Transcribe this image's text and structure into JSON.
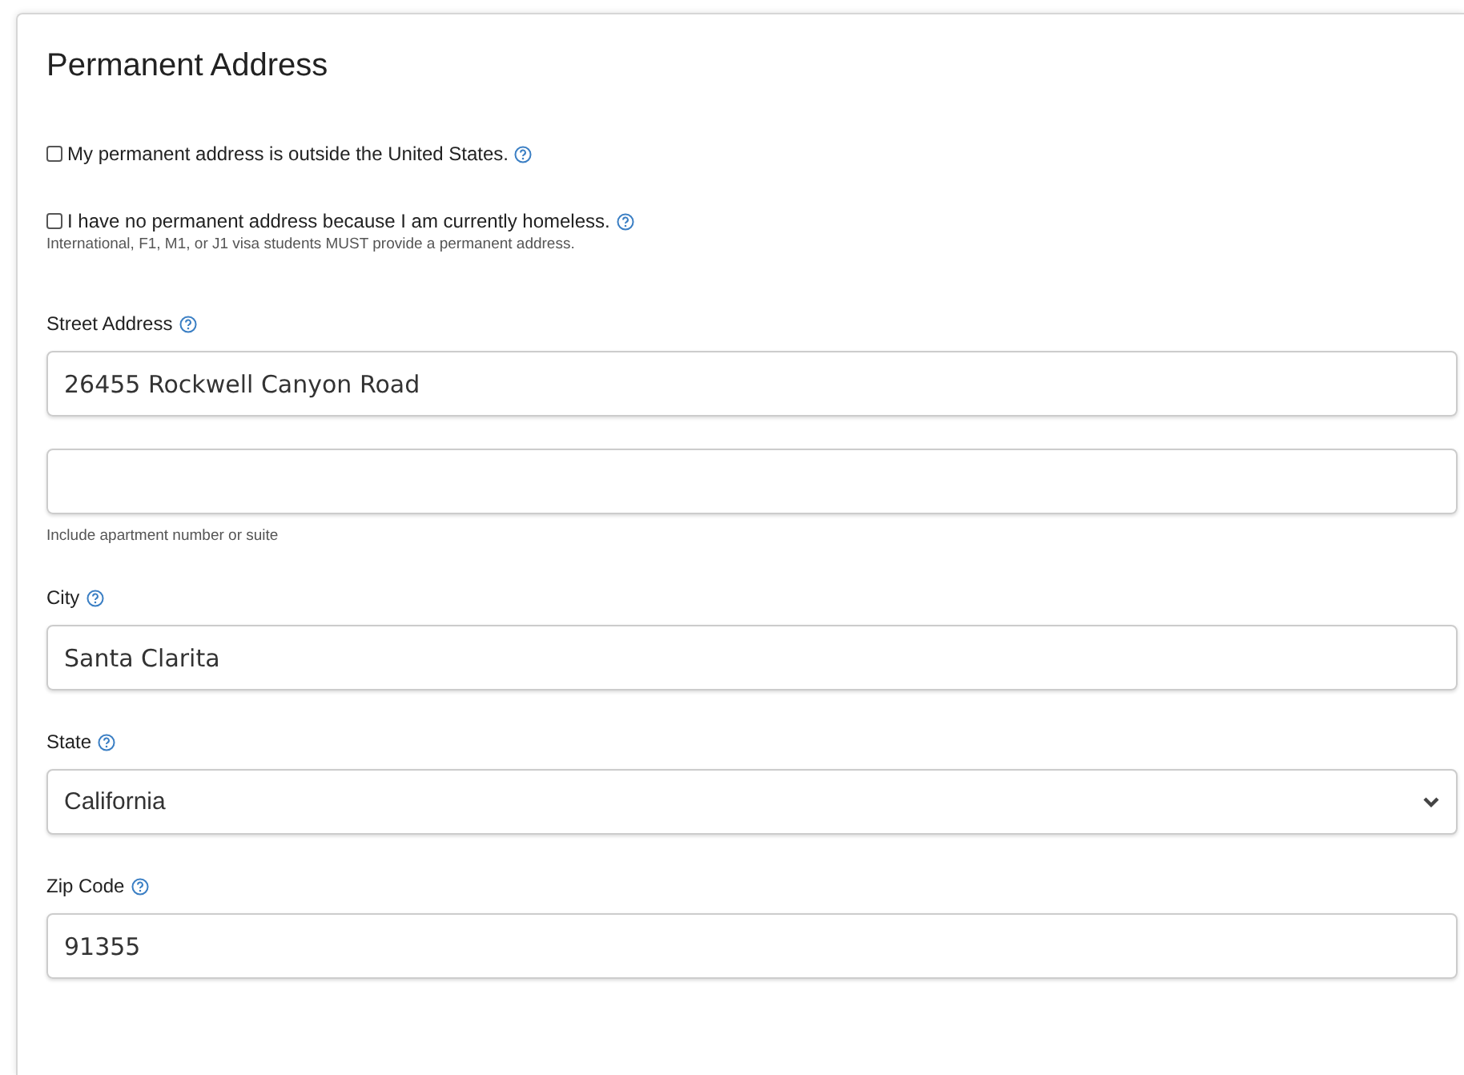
{
  "heading": "Permanent Address",
  "options": [
    {
      "label": "My permanent address is outside the United States.",
      "checked": false
    },
    {
      "label": "I have no permanent address because I am currently homeless.",
      "checked": false,
      "note": "International, F1, M1, or J1 visa students MUST provide a permanent address."
    }
  ],
  "fields": [
    {
      "label": "Street Address",
      "kind": "text",
      "inputs": [
        "26455 Rockwell Canyon Road"
      ],
      "second_line": true,
      "hint": "Include apartment number or suite"
    },
    {
      "label": "City",
      "kind": "text",
      "inputs": [
        "Santa Clarita"
      ]
    },
    {
      "label": "State",
      "kind": "select",
      "inputs": [
        "California"
      ]
    },
    {
      "label": "Zip Code",
      "kind": "text",
      "inputs": [
        "91355"
      ]
    }
  ]
}
